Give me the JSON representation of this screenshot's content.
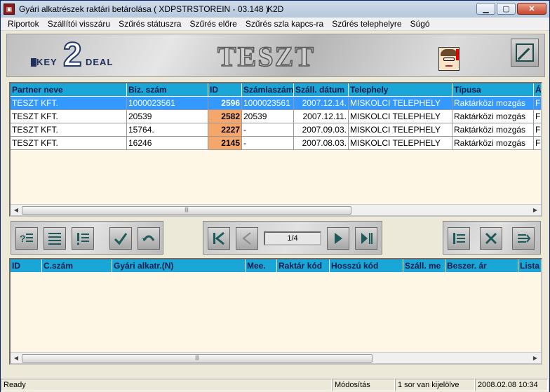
{
  "window": {
    "title": "Gyári alkatrészek raktári betárolása ( XDPSTRSTOREIN - 03.148 )",
    "app_code": "K2D",
    "icon": "app-icon",
    "buttons": [
      "minimize-icon",
      "maximize-icon",
      "close-icon"
    ]
  },
  "menu": {
    "items": [
      "Riportok",
      "Szállítói visszáru",
      "Szűrés státuszra",
      "Szűrés előre",
      "Szűrés szla kapcs-ra",
      "Szűrés telephelyre",
      "Súgó"
    ]
  },
  "banner": {
    "logo_key": "KEY",
    "logo_2": "2",
    "logo_deal": "DEAL",
    "title": "TESZT"
  },
  "grid1": {
    "columns": [
      "Partner neve",
      "Biz. szám",
      "ID",
      "Számlaszám",
      "Száll. dátum",
      "Telephely",
      "Típusa",
      "Á"
    ],
    "rows": [
      {
        "partner": "TESZT KFT.",
        "biz": "1000023561",
        "id": "2596",
        "szamla": "1000023561",
        "datum": "2007.12.14.",
        "telephely": "MISKOLCI TELEPHELY",
        "tipus": "Raktárközi mozgás",
        "a": "F"
      },
      {
        "partner": "TESZT KFT.",
        "biz": "20539",
        "id": "2582",
        "szamla": "20539",
        "datum": "2007.12.11.",
        "telephely": "MISKOLCI TELEPHELY",
        "tipus": "Raktárközi mozgás",
        "a": "F"
      },
      {
        "partner": "TESZT KFT.",
        "biz": "15764.",
        "id": "2227",
        "szamla": "-",
        "datum": "2007.09.03.",
        "telephely": "MISKOLCI TELEPHELY",
        "tipus": "Raktárközi mozgás",
        "a": "F"
      },
      {
        "partner": "TESZT KFT.",
        "biz": "16246",
        "id": "2145",
        "szamla": "-",
        "datum": "2007.08.03.",
        "telephely": "MISKOLCI TELEPHELY",
        "tipus": "Raktárközi mozgás",
        "a": "F"
      }
    ],
    "selected_row": 0
  },
  "toolbar": {
    "pager": "1/4"
  },
  "grid2": {
    "columns": [
      "ID",
      "C.szám",
      "Gyári alkatr.(N)",
      "Mee.",
      "Raktár kód",
      "Hosszú kód",
      "Száll. me",
      "Beszer. ár",
      "Lista"
    ]
  },
  "status": {
    "left": "Ready",
    "mode": "Módosítás",
    "selection": "1 sor van kijelölve",
    "datetime": "2008.02.08 10:34"
  }
}
